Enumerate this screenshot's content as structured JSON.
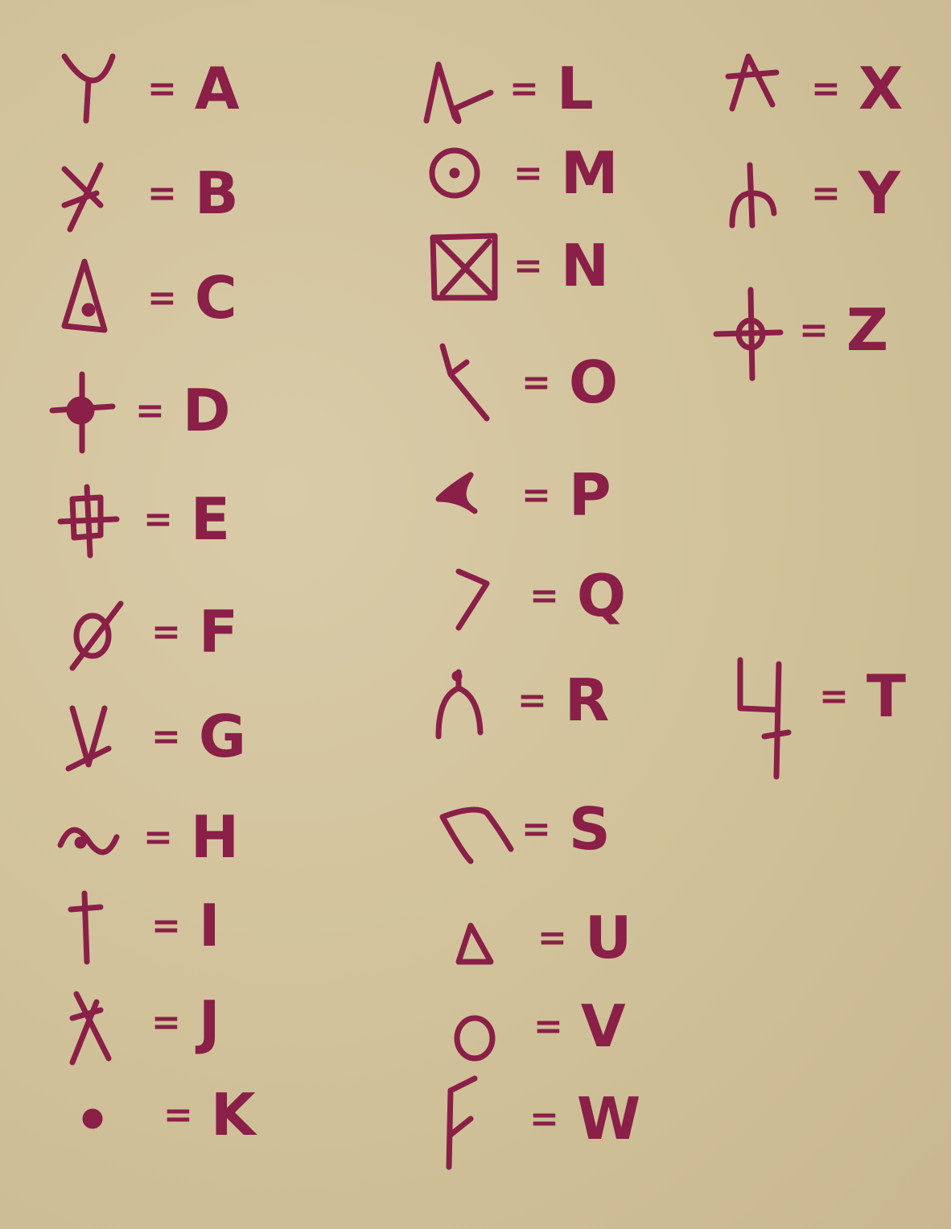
{
  "title": "",
  "ink_color": "#8a1f48",
  "paper_color": "#d4c59f",
  "equals_sign": "=",
  "columns": [
    {
      "entries": [
        {
          "symbol": "trident-y-symbol",
          "letter": "A"
        },
        {
          "symbol": "crossed-x-tail-symbol",
          "letter": "B"
        },
        {
          "symbol": "triangle-dot-symbol",
          "letter": "C"
        },
        {
          "symbol": "cross-filled-dot-symbol",
          "letter": "D"
        },
        {
          "symbol": "boxed-cross-symbol",
          "letter": "E"
        },
        {
          "symbol": "slashed-circle-symbol",
          "letter": "F"
        },
        {
          "symbol": "slashed-v-symbol",
          "letter": "G"
        },
        {
          "symbol": "tilde-dot-symbol",
          "letter": "H"
        },
        {
          "symbol": "dagger-symbol",
          "letter": "I"
        },
        {
          "symbol": "leaning-x-symbol",
          "letter": "J"
        },
        {
          "symbol": "dot-symbol",
          "letter": "K"
        }
      ]
    },
    {
      "entries": [
        {
          "symbol": "looped-a-symbol",
          "letter": "L"
        },
        {
          "symbol": "circle-dot-symbol",
          "letter": "M"
        },
        {
          "symbol": "boxed-x-symbol",
          "letter": "N"
        },
        {
          "symbol": "broken-x-symbol",
          "letter": "O"
        },
        {
          "symbol": "crescent-symbol",
          "letter": "P"
        },
        {
          "symbol": "angle-symbol",
          "letter": "Q"
        },
        {
          "symbol": "arch-dot-symbol",
          "letter": "R"
        },
        {
          "symbol": "hook-arch-symbol",
          "letter": "S"
        },
        {
          "symbol": "small-triangle-symbol",
          "letter": "U"
        },
        {
          "symbol": "circle-symbol",
          "letter": "V"
        },
        {
          "symbol": "f-shape-symbol",
          "letter": "W"
        }
      ]
    },
    {
      "entries": [
        {
          "symbol": "crossed-a-symbol",
          "letter": "X"
        },
        {
          "symbol": "arch-stem-symbol",
          "letter": "Y"
        },
        {
          "symbol": "cross-circle-symbol",
          "letter": "Z"
        },
        {
          "symbol": "four-tail-symbol",
          "letter": "T"
        }
      ]
    }
  ]
}
